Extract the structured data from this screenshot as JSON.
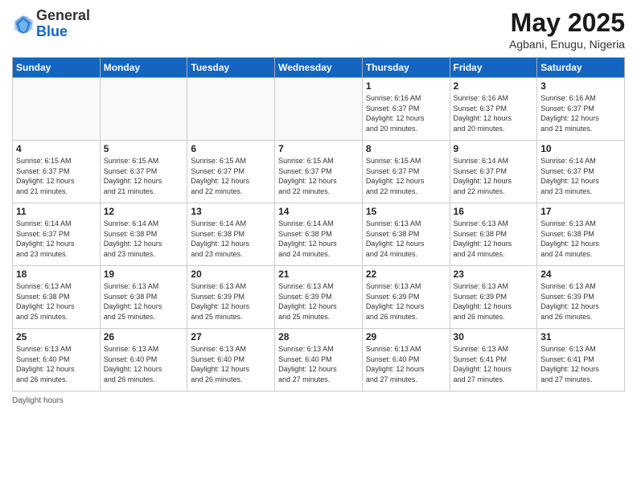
{
  "logo": {
    "general": "General",
    "blue": "Blue"
  },
  "header": {
    "month": "May 2025",
    "location": "Agbani, Enugu, Nigeria"
  },
  "weekdays": [
    "Sunday",
    "Monday",
    "Tuesday",
    "Wednesday",
    "Thursday",
    "Friday",
    "Saturday"
  ],
  "footer": {
    "note": "Daylight hours"
  },
  "weeks": [
    [
      {
        "day": "",
        "info": ""
      },
      {
        "day": "",
        "info": ""
      },
      {
        "day": "",
        "info": ""
      },
      {
        "day": "",
        "info": ""
      },
      {
        "day": "1",
        "info": "Sunrise: 6:16 AM\nSunset: 6:37 PM\nDaylight: 12 hours\nand 20 minutes."
      },
      {
        "day": "2",
        "info": "Sunrise: 6:16 AM\nSunset: 6:37 PM\nDaylight: 12 hours\nand 20 minutes."
      },
      {
        "day": "3",
        "info": "Sunrise: 6:16 AM\nSunset: 6:37 PM\nDaylight: 12 hours\nand 21 minutes."
      }
    ],
    [
      {
        "day": "4",
        "info": "Sunrise: 6:15 AM\nSunset: 6:37 PM\nDaylight: 12 hours\nand 21 minutes."
      },
      {
        "day": "5",
        "info": "Sunrise: 6:15 AM\nSunset: 6:37 PM\nDaylight: 12 hours\nand 21 minutes."
      },
      {
        "day": "6",
        "info": "Sunrise: 6:15 AM\nSunset: 6:37 PM\nDaylight: 12 hours\nand 22 minutes."
      },
      {
        "day": "7",
        "info": "Sunrise: 6:15 AM\nSunset: 6:37 PM\nDaylight: 12 hours\nand 22 minutes."
      },
      {
        "day": "8",
        "info": "Sunrise: 6:15 AM\nSunset: 6:37 PM\nDaylight: 12 hours\nand 22 minutes."
      },
      {
        "day": "9",
        "info": "Sunrise: 6:14 AM\nSunset: 6:37 PM\nDaylight: 12 hours\nand 22 minutes."
      },
      {
        "day": "10",
        "info": "Sunrise: 6:14 AM\nSunset: 6:37 PM\nDaylight: 12 hours\nand 23 minutes."
      }
    ],
    [
      {
        "day": "11",
        "info": "Sunrise: 6:14 AM\nSunset: 6:37 PM\nDaylight: 12 hours\nand 23 minutes."
      },
      {
        "day": "12",
        "info": "Sunrise: 6:14 AM\nSunset: 6:38 PM\nDaylight: 12 hours\nand 23 minutes."
      },
      {
        "day": "13",
        "info": "Sunrise: 6:14 AM\nSunset: 6:38 PM\nDaylight: 12 hours\nand 23 minutes."
      },
      {
        "day": "14",
        "info": "Sunrise: 6:14 AM\nSunset: 6:38 PM\nDaylight: 12 hours\nand 24 minutes."
      },
      {
        "day": "15",
        "info": "Sunrise: 6:13 AM\nSunset: 6:38 PM\nDaylight: 12 hours\nand 24 minutes."
      },
      {
        "day": "16",
        "info": "Sunrise: 6:13 AM\nSunset: 6:38 PM\nDaylight: 12 hours\nand 24 minutes."
      },
      {
        "day": "17",
        "info": "Sunrise: 6:13 AM\nSunset: 6:38 PM\nDaylight: 12 hours\nand 24 minutes."
      }
    ],
    [
      {
        "day": "18",
        "info": "Sunrise: 6:13 AM\nSunset: 6:38 PM\nDaylight: 12 hours\nand 25 minutes."
      },
      {
        "day": "19",
        "info": "Sunrise: 6:13 AM\nSunset: 6:38 PM\nDaylight: 12 hours\nand 25 minutes."
      },
      {
        "day": "20",
        "info": "Sunrise: 6:13 AM\nSunset: 6:39 PM\nDaylight: 12 hours\nand 25 minutes."
      },
      {
        "day": "21",
        "info": "Sunrise: 6:13 AM\nSunset: 6:39 PM\nDaylight: 12 hours\nand 25 minutes."
      },
      {
        "day": "22",
        "info": "Sunrise: 6:13 AM\nSunset: 6:39 PM\nDaylight: 12 hours\nand 26 minutes."
      },
      {
        "day": "23",
        "info": "Sunrise: 6:13 AM\nSunset: 6:39 PM\nDaylight: 12 hours\nand 26 minutes."
      },
      {
        "day": "24",
        "info": "Sunrise: 6:13 AM\nSunset: 6:39 PM\nDaylight: 12 hours\nand 26 minutes."
      }
    ],
    [
      {
        "day": "25",
        "info": "Sunrise: 6:13 AM\nSunset: 6:40 PM\nDaylight: 12 hours\nand 26 minutes."
      },
      {
        "day": "26",
        "info": "Sunrise: 6:13 AM\nSunset: 6:40 PM\nDaylight: 12 hours\nand 26 minutes."
      },
      {
        "day": "27",
        "info": "Sunrise: 6:13 AM\nSunset: 6:40 PM\nDaylight: 12 hours\nand 26 minutes."
      },
      {
        "day": "28",
        "info": "Sunrise: 6:13 AM\nSunset: 6:40 PM\nDaylight: 12 hours\nand 27 minutes."
      },
      {
        "day": "29",
        "info": "Sunrise: 6:13 AM\nSunset: 6:40 PM\nDaylight: 12 hours\nand 27 minutes."
      },
      {
        "day": "30",
        "info": "Sunrise: 6:13 AM\nSunset: 6:41 PM\nDaylight: 12 hours\nand 27 minutes."
      },
      {
        "day": "31",
        "info": "Sunrise: 6:13 AM\nSunset: 6:41 PM\nDaylight: 12 hours\nand 27 minutes."
      }
    ]
  ]
}
